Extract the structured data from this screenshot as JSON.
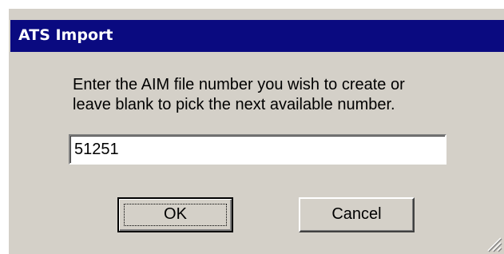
{
  "window": {
    "title": "ATS Import"
  },
  "prompt": {
    "line1": "Enter the AIM file number you wish to create or",
    "line2": "leave blank to pick the next available number."
  },
  "file_number_input": {
    "value": "51251"
  },
  "buttons": {
    "ok_label": "OK",
    "cancel_label": "Cancel"
  },
  "colors": {
    "titlebar": "#0a0a80",
    "dialog_face": "#d4d0c8"
  }
}
